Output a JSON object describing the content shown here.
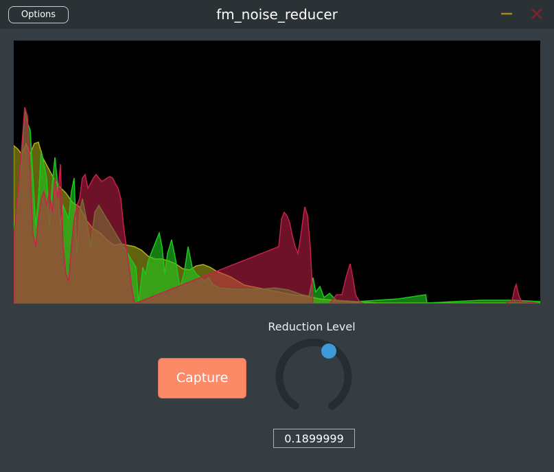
{
  "window": {
    "title": "fm_noise_reducer",
    "options_label": "Options",
    "minimize_icon": "minimize-icon",
    "close_icon": "close-icon",
    "minimize_color": "#a88b1f",
    "close_color": "#8e1f24"
  },
  "spectrum": {
    "background": "#000000",
    "series_colors": {
      "green": "#1ec81e",
      "yellow": "#b2b21a",
      "red": "#c8204a"
    }
  },
  "controls": {
    "capture_label": "Capture",
    "knob_label": "Reduction Level",
    "knob_value": "0.1899999",
    "knob_fraction": 0.19,
    "accent_color": "#3d9ad6",
    "capture_color": "#fc8a67"
  }
}
